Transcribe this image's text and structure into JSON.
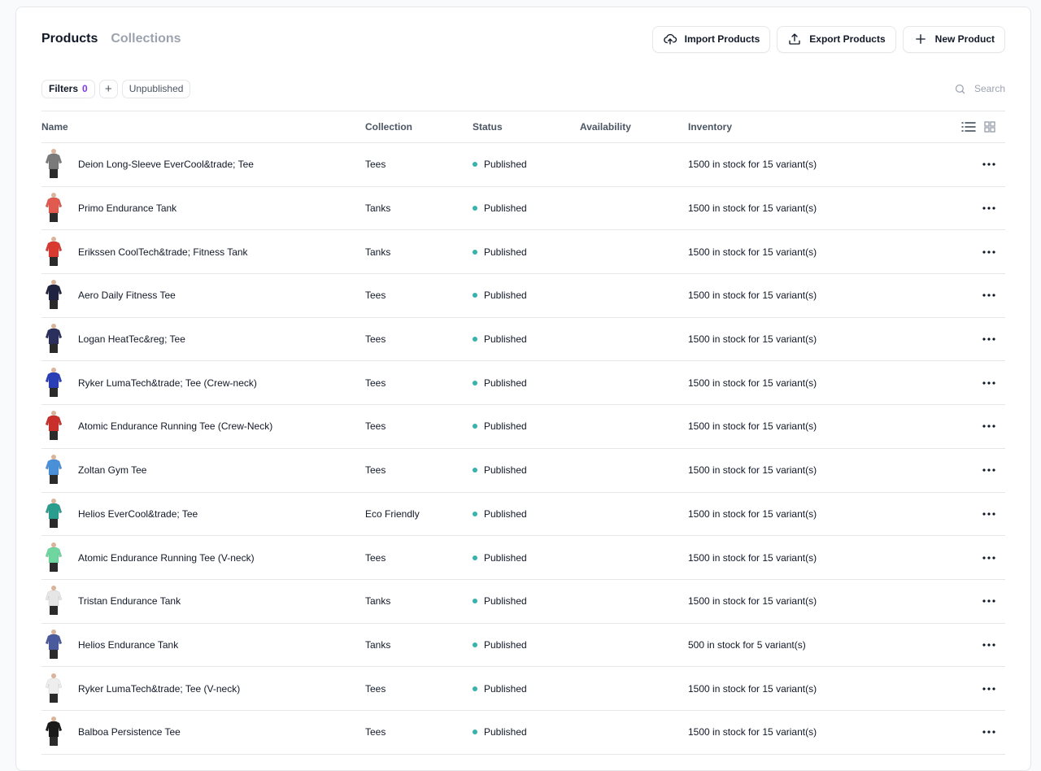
{
  "tabs": [
    {
      "label": "Products",
      "active": true
    },
    {
      "label": "Collections",
      "active": false
    }
  ],
  "actions": {
    "import_label": "Import Products",
    "export_label": "Export Products",
    "new_label": "New Product"
  },
  "filters": {
    "label": "Filters",
    "count": "0",
    "add_symbol": "+",
    "chip": "Unpublished"
  },
  "search": {
    "placeholder": "Search"
  },
  "table": {
    "headers": {
      "name": "Name",
      "collection": "Collection",
      "status": "Status",
      "availability": "Availability",
      "inventory": "Inventory"
    },
    "rows": [
      {
        "name": "Deion Long-Sleeve EverCool&trade; Tee",
        "collection": "Tees",
        "status": "Published",
        "inventory": "1500 in stock for 15 variant(s)",
        "color": "#7a7a7a"
      },
      {
        "name": "Primo Endurance Tank",
        "collection": "Tanks",
        "status": "Published",
        "inventory": "1500 in stock for 15 variant(s)",
        "color": "#e05a4f"
      },
      {
        "name": "Erikssen CoolTech&trade; Fitness Tank",
        "collection": "Tanks",
        "status": "Published",
        "inventory": "1500 in stock for 15 variant(s)",
        "color": "#d83a32"
      },
      {
        "name": "Aero Daily Fitness Tee",
        "collection": "Tees",
        "status": "Published",
        "inventory": "1500 in stock for 15 variant(s)",
        "color": "#1f2340"
      },
      {
        "name": "Logan HeatTec&reg; Tee",
        "collection": "Tees",
        "status": "Published",
        "inventory": "1500 in stock for 15 variant(s)",
        "color": "#2a2f5c"
      },
      {
        "name": "Ryker LumaTech&trade; Tee (Crew-neck)",
        "collection": "Tees",
        "status": "Published",
        "inventory": "1500 in stock for 15 variant(s)",
        "color": "#2a3fb5"
      },
      {
        "name": "Atomic Endurance Running Tee (Crew-Neck)",
        "collection": "Tees",
        "status": "Published",
        "inventory": "1500 in stock for 15 variant(s)",
        "color": "#c9302c"
      },
      {
        "name": "Zoltan Gym Tee",
        "collection": "Tees",
        "status": "Published",
        "inventory": "1500 in stock for 15 variant(s)",
        "color": "#4a90d9"
      },
      {
        "name": "Helios EverCool&trade; Tee",
        "collection": "Eco Friendly",
        "status": "Published",
        "inventory": "1500 in stock for 15 variant(s)",
        "color": "#2a9d8f"
      },
      {
        "name": "Atomic Endurance Running Tee (V-neck)",
        "collection": "Tees",
        "status": "Published",
        "inventory": "1500 in stock for 15 variant(s)",
        "color": "#6fd6a0"
      },
      {
        "name": "Tristan Endurance Tank",
        "collection": "Tanks",
        "status": "Published",
        "inventory": "1500 in stock for 15 variant(s)",
        "color": "#e6e6e6"
      },
      {
        "name": "Helios Endurance Tank",
        "collection": "Tanks",
        "status": "Published",
        "inventory": "500 in stock for 5 variant(s)",
        "color": "#4a5a9c"
      },
      {
        "name": "Ryker LumaTech&trade; Tee (V-neck)",
        "collection": "Tees",
        "status": "Published",
        "inventory": "1500 in stock for 15 variant(s)",
        "color": "#eeeeee"
      },
      {
        "name": "Balboa Persistence Tee",
        "collection": "Tees",
        "status": "Published",
        "inventory": "1500 in stock for 15 variant(s)",
        "color": "#1a1a1a"
      }
    ]
  },
  "colors": {
    "status_published": "#38b2ac",
    "filter_count": "#7c3aed"
  }
}
